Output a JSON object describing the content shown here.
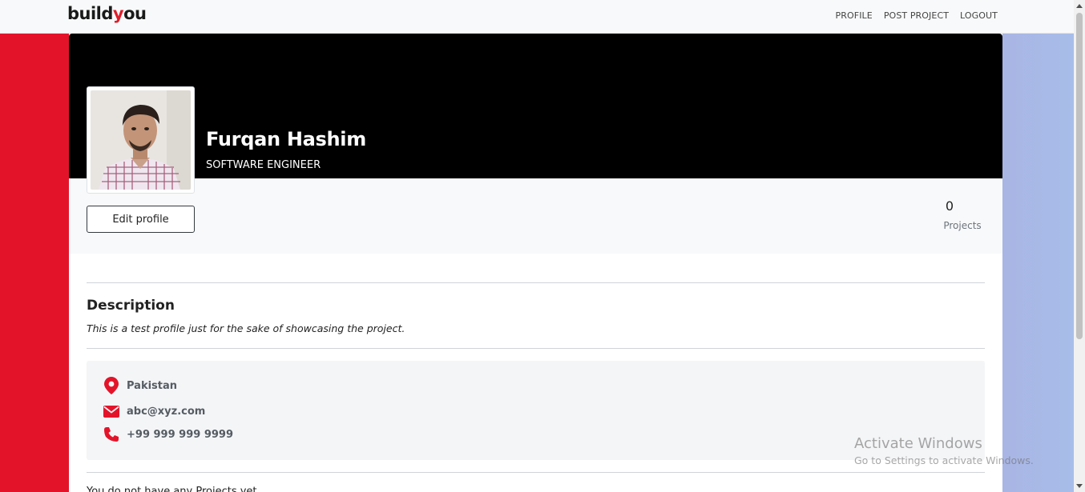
{
  "navbar": {
    "brand_prefix": "build",
    "brand_dot": "y",
    "brand_suffix": "ou",
    "links": [
      "PROFILE",
      "POST PROJECT",
      "LOGOUT"
    ]
  },
  "profile": {
    "name": "Furqan Hashim",
    "role": "SOFTWARE ENGINEER",
    "edit_button": "Edit profile",
    "projects_count": "0",
    "projects_label": "Projects"
  },
  "description": {
    "title": "Description",
    "text": "This is a test profile just for the sake of showcasing the project."
  },
  "contact": {
    "location": "Pakistan",
    "email": "abc@xyz.com",
    "phone": "+99 999 999 9999"
  },
  "projects": {
    "empty_message": "You do not have any Projects yet."
  },
  "watermark": {
    "title": "Activate Windows",
    "subtitle": "Go to Settings to activate Windows."
  },
  "colors": {
    "accent_red": "#e3142a",
    "cover": "#000000",
    "right_band": "#a9b5e4"
  }
}
